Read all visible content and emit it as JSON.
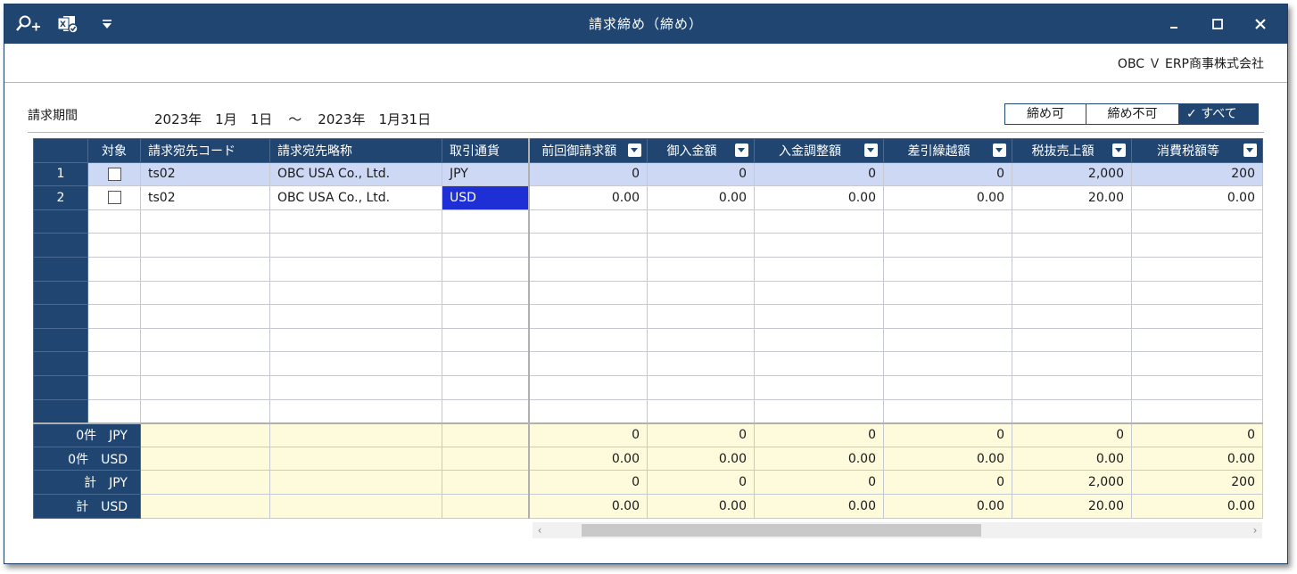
{
  "window": {
    "title": "請求締め（締め）",
    "company": "OBC Ｖ ERP商事株式会社"
  },
  "toolbar": {
    "icons": [
      "search-add-icon",
      "excel-export-icon",
      "dropdown-menu-icon"
    ],
    "plus": "+"
  },
  "period": {
    "label": "請求期間",
    "from": "2023年　1月　1日",
    "separator": "～",
    "to": "2023年　1月31日"
  },
  "filter": {
    "options": [
      "締め可",
      "締め不可",
      "すべて"
    ],
    "selected": "すべて",
    "check": "✓"
  },
  "grid": {
    "columns": [
      "対象",
      "請求宛先コード",
      "請求宛先略称",
      "取引通貨",
      "前回御請求額",
      "御入金額",
      "入金調整額",
      "差引繰越額",
      "税抜売上額",
      "消費税額等"
    ],
    "rows": [
      {
        "no": "1",
        "code": "ts02",
        "name": "OBC USA Co., Ltd.",
        "currency": "JPY",
        "values": [
          "0",
          "0",
          "0",
          "0",
          "2,000",
          "200"
        ]
      },
      {
        "no": "2",
        "code": "ts02",
        "name": "OBC USA Co., Ltd.",
        "currency": "USD",
        "values": [
          "0.00",
          "0.00",
          "0.00",
          "0.00",
          "20.00",
          "0.00"
        ]
      }
    ],
    "totals": [
      {
        "label": "0件　JPY",
        "values": [
          "0",
          "0",
          "0",
          "0",
          "0",
          "0"
        ]
      },
      {
        "label": "0件　USD",
        "values": [
          "0.00",
          "0.00",
          "0.00",
          "0.00",
          "0.00",
          "0.00"
        ]
      },
      {
        "label": "計　JPY",
        "values": [
          "0",
          "0",
          "0",
          "0",
          "2,000",
          "200"
        ]
      },
      {
        "label": "計　USD",
        "values": [
          "0.00",
          "0.00",
          "0.00",
          "0.00",
          "20.00",
          "0.00"
        ]
      }
    ]
  },
  "colors": {
    "header": "#1f4570",
    "selected_row": "#cdd8f4",
    "selected_cell": "#1f2fd6",
    "totals_bg": "#fdfbdc"
  }
}
